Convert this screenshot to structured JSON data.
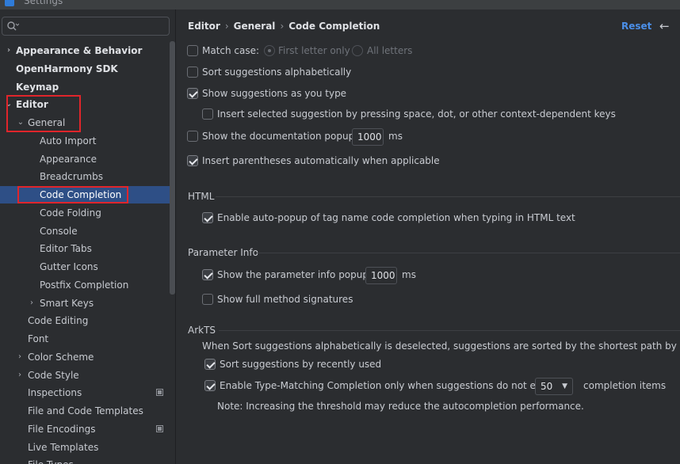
{
  "window": {
    "title": "Settings"
  },
  "search": {
    "placeholder": ""
  },
  "sidebar": {
    "items": [
      {
        "label": "Appearance & Behavior",
        "arrow": "›"
      },
      {
        "label": "OpenHarmony SDK"
      },
      {
        "label": "Keymap"
      },
      {
        "label": "Editor",
        "arrow": "⌄"
      },
      {
        "label": "General",
        "arrow": "⌄"
      },
      {
        "label": "Auto Import"
      },
      {
        "label": "Appearance"
      },
      {
        "label": "Breadcrumbs"
      },
      {
        "label": "Code Completion"
      },
      {
        "label": "Code Folding"
      },
      {
        "label": "Console"
      },
      {
        "label": "Editor Tabs"
      },
      {
        "label": "Gutter Icons"
      },
      {
        "label": "Postfix Completion"
      },
      {
        "label": "Smart Keys",
        "arrow": "›"
      },
      {
        "label": "Code Editing"
      },
      {
        "label": "Font"
      },
      {
        "label": "Color Scheme",
        "arrow": "›"
      },
      {
        "label": "Code Style",
        "arrow": "›"
      },
      {
        "label": "Inspections"
      },
      {
        "label": "File and Code Templates"
      },
      {
        "label": "File Encodings"
      },
      {
        "label": "Live Templates"
      },
      {
        "label": "File Types"
      }
    ]
  },
  "breadcrumb": [
    "Editor",
    "General",
    "Code Completion"
  ],
  "header": {
    "reset": "Reset",
    "back_icon": "←"
  },
  "options": {
    "match_case": "Match case:",
    "first_letter_only": "First letter only",
    "all_letters": "All letters",
    "sort_alpha": "Sort suggestions alphabetically",
    "show_as_you_type": "Show suggestions as you type",
    "insert_selected": "Insert selected suggestion by pressing space, dot, or other context-dependent keys",
    "show_doc_popup": "Show the documentation popup in",
    "doc_popup_ms": "1000",
    "ms": "ms",
    "insert_parens": "Insert parentheses automatically when applicable"
  },
  "html_section": {
    "title": "HTML",
    "auto_popup": "Enable auto-popup of tag name code completion when typing in HTML text"
  },
  "param_section": {
    "title": "Parameter Info",
    "show_param_popup": "Show the parameter info popup in",
    "param_popup_ms": "1000",
    "ms": "ms",
    "full_signatures": "Show full method signatures"
  },
  "arkts_section": {
    "title": "ArkTS",
    "note_deselected": "When Sort suggestions alphabetically is deselected, suggestions are sorted by the shortest path by default",
    "sort_recent": "Sort suggestions by recently used",
    "type_matching": "Enable Type-Matching Completion only when suggestions do not exceed",
    "limit_value": "50",
    "completion_items": "completion items",
    "threshold_note": "Note: Increasing the threshold may reduce the autocompletion performance."
  },
  "colors": {
    "selection": "#2e4f86",
    "accent": "#4b8fe8",
    "highlight_box": "#e0252b"
  }
}
